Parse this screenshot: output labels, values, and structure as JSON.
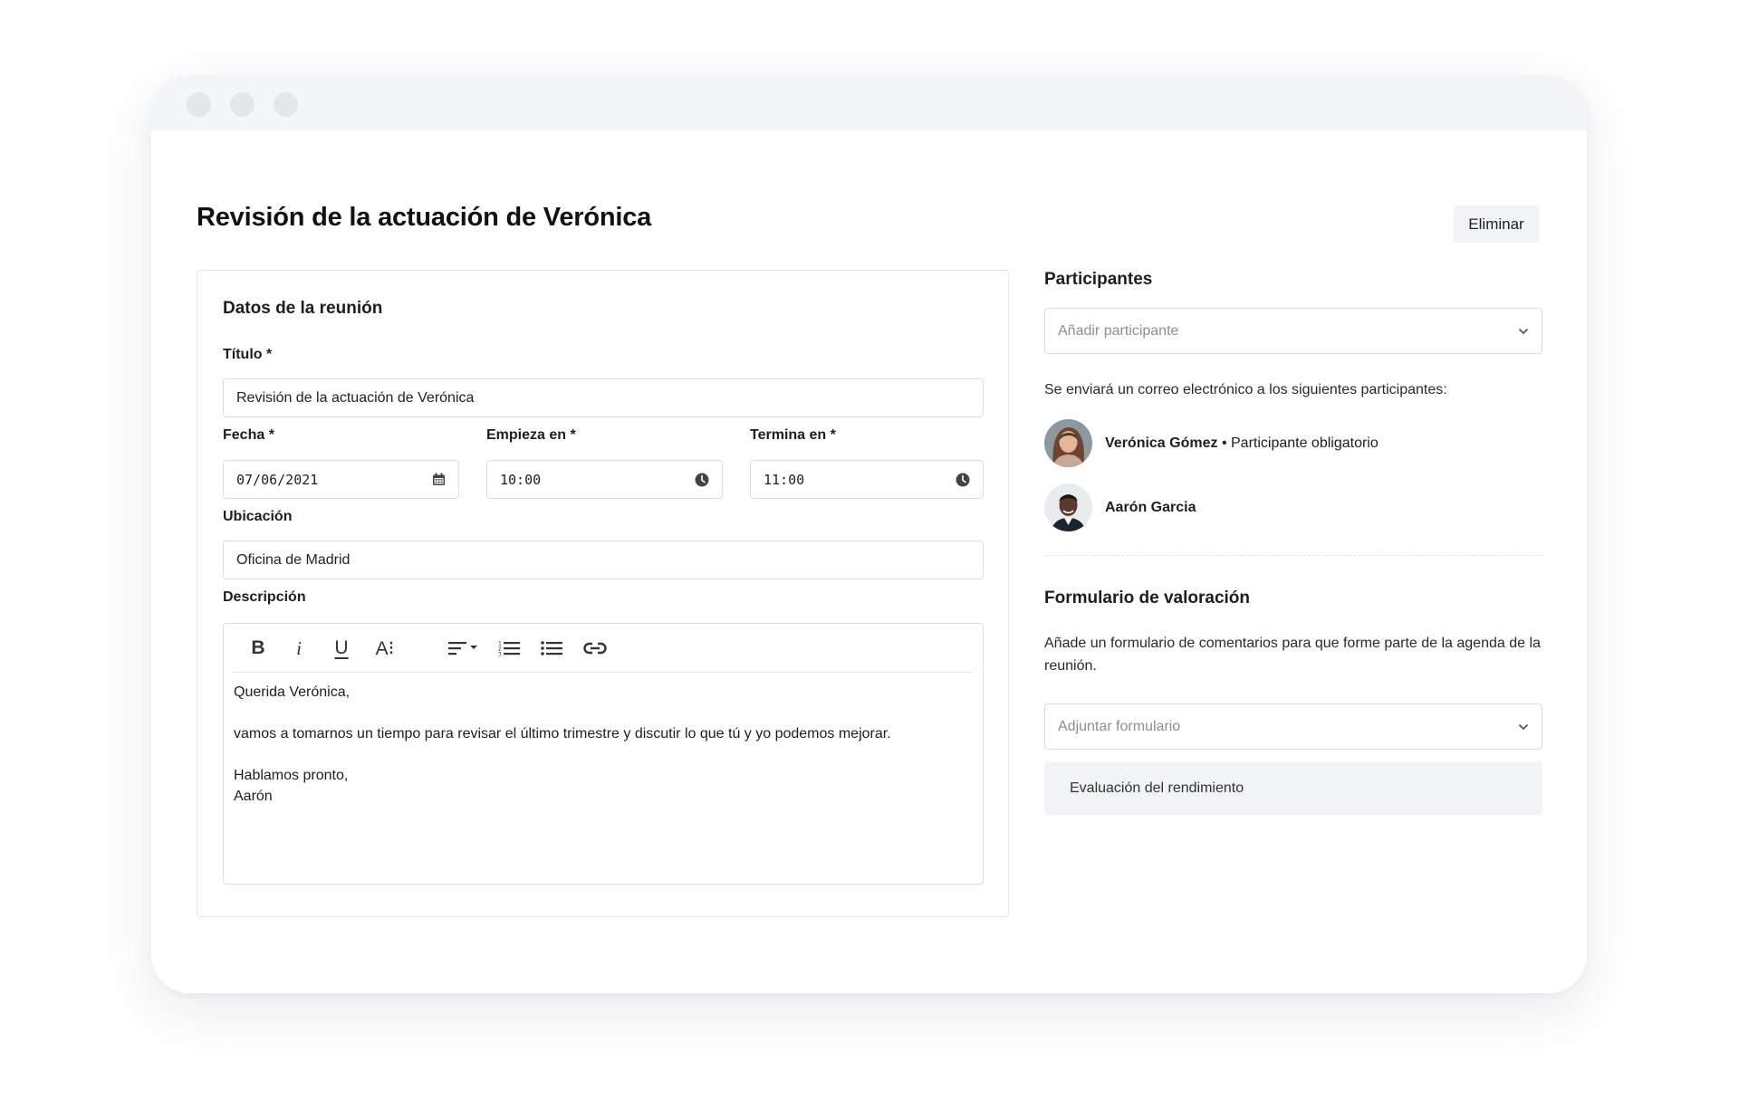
{
  "page": {
    "title": "Revisión de la actuación de Verónica",
    "delete_label": "Eliminar"
  },
  "meeting": {
    "section_title": "Datos de la reunión",
    "title_label": "Título *",
    "title_value": "Revisión de la actuación de Verónica",
    "date_label": "Fecha *",
    "date_value": "07/06/2021",
    "start_label": "Empieza en *",
    "start_value": "10:00",
    "end_label": "Termina en *",
    "end_value": "11:00",
    "location_label": "Ubicación",
    "location_value": "Oficina de Madrid",
    "description_label": "Descripción",
    "toolbar": {
      "bold": "B",
      "italic": "i",
      "underline": "U",
      "font_size": "A⁝"
    },
    "description": {
      "line1": "Querida Verónica,",
      "line2": "vamos a tomarnos un tiempo para revisar el último trimestre y discutir lo que tú y yo podemos mejorar.",
      "line3": "Hablamos pronto,",
      "line4": "Aarón"
    }
  },
  "participants": {
    "section_title": "Participantes",
    "add_placeholder": "Añadir participante",
    "notice": "Se enviará un correo electrónico a los siguientes participantes:",
    "list": [
      {
        "name": "Verónica Gómez",
        "role": " • Participante obligatorio"
      },
      {
        "name": "Aarón Garcia",
        "role": ""
      }
    ]
  },
  "feedback": {
    "section_title": "Formulario de valoración",
    "description": "Añade un formulario de comentarios para que forme parte de la agenda de la reunión.",
    "attach_placeholder": "Adjuntar formulario",
    "attached_form": "Evaluación del rendimiento"
  },
  "colors": {
    "titlebar": "#f2f6f8",
    "border": "#d9dde0",
    "chip_bg": "#f1f3f4"
  }
}
